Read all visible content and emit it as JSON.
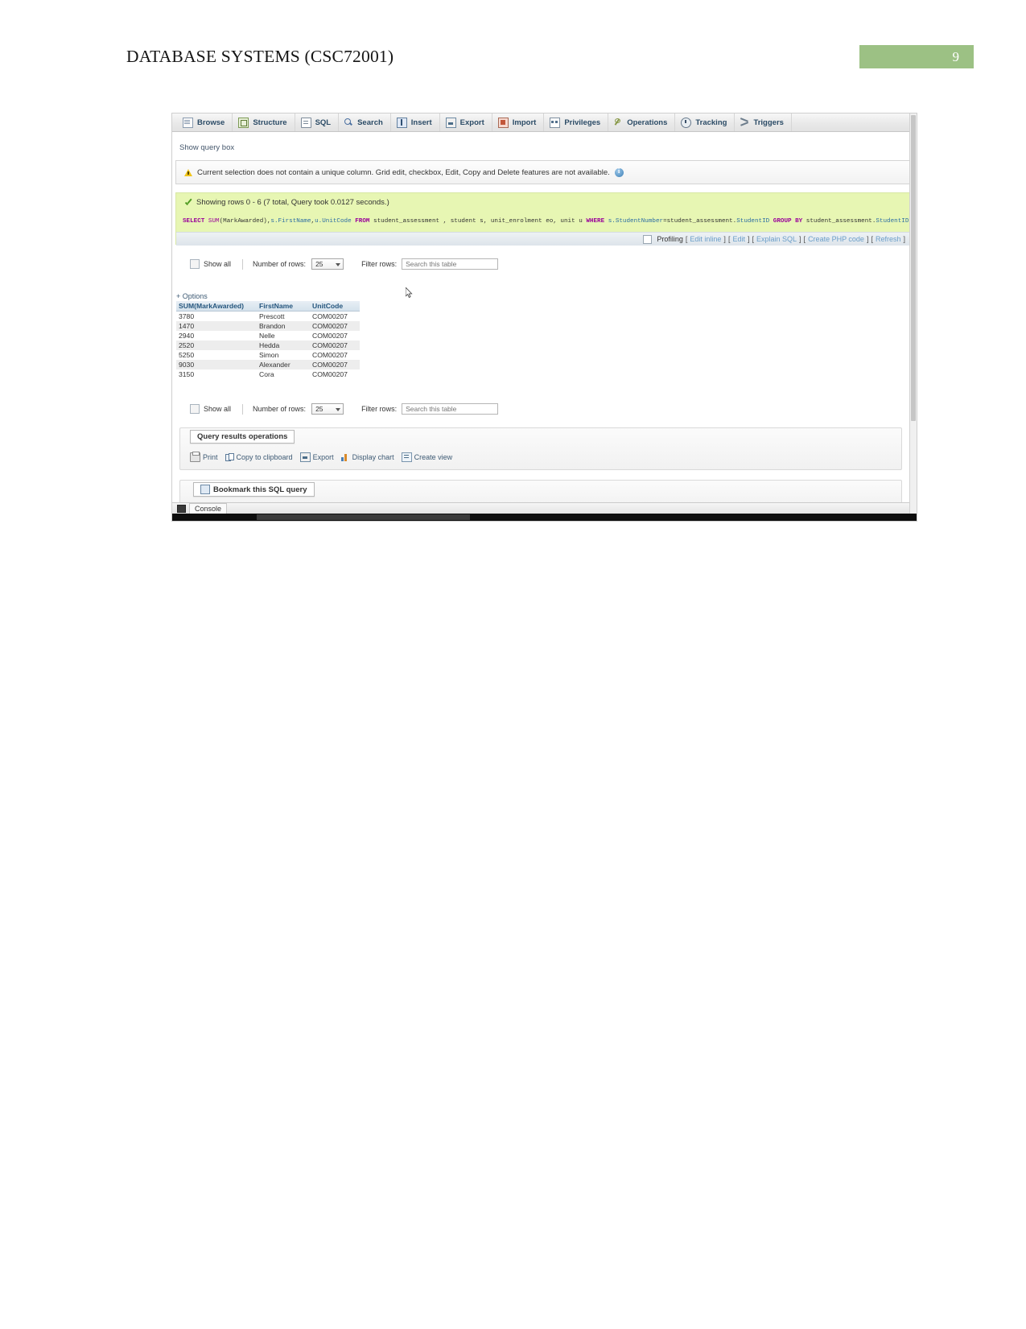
{
  "document": {
    "header_title": "DATABASE SYSTEMS (CSC72001)",
    "page_number": "9",
    "header_accent_color": "#9cc184"
  },
  "phpmyadmin": {
    "nav_tabs": [
      {
        "label": "Browse",
        "icon": "browse-icon"
      },
      {
        "label": "Structure",
        "icon": "structure-icon"
      },
      {
        "label": "SQL",
        "icon": "sql-icon"
      },
      {
        "label": "Search",
        "icon": "search-icon"
      },
      {
        "label": "Insert",
        "icon": "insert-icon"
      },
      {
        "label": "Export",
        "icon": "export-icon"
      },
      {
        "label": "Import",
        "icon": "import-icon"
      },
      {
        "label": "Privileges",
        "icon": "privileges-icon"
      },
      {
        "label": "Operations",
        "icon": "operations-icon"
      },
      {
        "label": "Tracking",
        "icon": "tracking-icon"
      },
      {
        "label": "Triggers",
        "icon": "triggers-icon"
      }
    ],
    "show_query_box": "Show query box",
    "warning": {
      "icon": "warning-triangle-icon",
      "text": "Current selection does not contain a unique column. Grid edit, checkbox, Edit, Copy and Delete features are not available.",
      "help_icon": "info-circle-icon"
    },
    "success": {
      "icon": "check-icon",
      "text": "Showing rows 0 - 6 (7 total, Query took 0.0127 seconds.)",
      "background_color": "#e7f6b3"
    },
    "sql": {
      "full_text": "SELECT SUM(MarkAwarded),s.FirstName,u.UnitCode FROM student_assessment , student s, unit_enrolment eo, unit u WHERE s.StudentNumber=student_assessment.StudentID GROUP BY student_assessment.StudentID",
      "tokens": [
        {
          "t": "SELECT",
          "c": "kw"
        },
        {
          "t": " ",
          "c": "plain"
        },
        {
          "t": "SUM",
          "c": "fn"
        },
        {
          "t": "(MarkAwarded),",
          "c": "plain"
        },
        {
          "t": "s.FirstName",
          "c": "col"
        },
        {
          "t": ",",
          "c": "plain"
        },
        {
          "t": "u.UnitCode",
          "c": "col"
        },
        {
          "t": " ",
          "c": "plain"
        },
        {
          "t": "FROM",
          "c": "kw"
        },
        {
          "t": " student_assessment , student s, unit_enrolment eo, unit u ",
          "c": "plain"
        },
        {
          "t": "WHERE",
          "c": "kw"
        },
        {
          "t": " ",
          "c": "plain"
        },
        {
          "t": "s.StudentNumber",
          "c": "col"
        },
        {
          "t": "=student_assessment.",
          "c": "plain"
        },
        {
          "t": "StudentID",
          "c": "col"
        },
        {
          "t": " ",
          "c": "plain"
        },
        {
          "t": "GROUP BY",
          "c": "kw"
        },
        {
          "t": " student_assessment.",
          "c": "plain"
        },
        {
          "t": "StudentID",
          "c": "col"
        }
      ]
    },
    "profiling": {
      "checkbox_label": "Profiling",
      "links": [
        "Edit inline",
        "Edit",
        "Explain SQL",
        "Create PHP code",
        "Refresh"
      ],
      "bracket_open": "[",
      "bracket_close": "]"
    },
    "controls": {
      "show_all": "Show all",
      "number_of_rows_label": "Number of rows:",
      "rows_value": "25",
      "filter_rows_label": "Filter rows:",
      "filter_placeholder": "Search this table"
    },
    "options_link": "+ Options",
    "results": {
      "columns": [
        "SUM(MarkAwarded)",
        "FirstName",
        "UnitCode"
      ],
      "rows": [
        [
          "3780",
          "Prescott",
          "COM00207"
        ],
        [
          "1470",
          "Brandon",
          "COM00207"
        ],
        [
          "2940",
          "Nelle",
          "COM00207"
        ],
        [
          "2520",
          "Hedda",
          "COM00207"
        ],
        [
          "5250",
          "Simon",
          "COM00207"
        ],
        [
          "9030",
          "Alexander",
          "COM00207"
        ],
        [
          "3150",
          "Cora",
          "COM00207"
        ]
      ]
    },
    "query_results_operations": {
      "legend": "Query results operations",
      "actions": [
        {
          "label": "Print",
          "icon": "printer-icon"
        },
        {
          "label": "Copy to clipboard",
          "icon": "clipboard-icon"
        },
        {
          "label": "Export",
          "icon": "export-icon"
        },
        {
          "label": "Display chart",
          "icon": "bar-chart-icon"
        },
        {
          "label": "Create view",
          "icon": "view-icon"
        }
      ]
    },
    "bookmark": {
      "legend": "Bookmark this SQL query",
      "icon": "bookmark-icon"
    },
    "console": {
      "label": "Console",
      "icon": "console-icon"
    }
  }
}
